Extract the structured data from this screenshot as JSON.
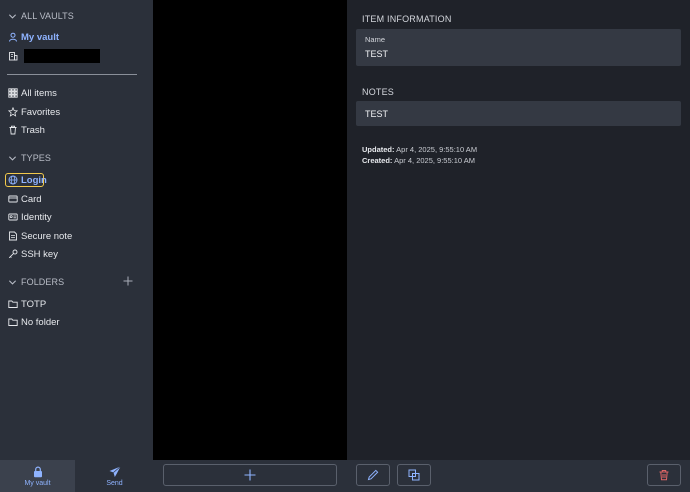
{
  "sidebar": {
    "vaults_header": "ALL VAULTS",
    "my_vault": "My vault",
    "all_items": "All items",
    "favorites": "Favorites",
    "trash": "Trash",
    "types_header": "TYPES",
    "types": [
      "Login",
      "Card",
      "Identity",
      "Secure note",
      "SSH key"
    ],
    "folders_header": "FOLDERS",
    "folders": [
      "TOTP",
      "No folder"
    ]
  },
  "detail": {
    "item_info_title": "ITEM INFORMATION",
    "name_label": "Name",
    "name_value": "TEST",
    "notes_title": "NOTES",
    "notes_value": "TEST",
    "updated_label": "Updated:",
    "updated_value": "Apr 4, 2025, 9:55:10 AM",
    "created_label": "Created:",
    "created_value": "Apr 4, 2025, 9:55:10 AM"
  },
  "bottom_nav": {
    "my_vault": "My vault",
    "send": "Send"
  },
  "colors": {
    "accent": "#8fb3ff",
    "focus_outline": "#f2c94c",
    "danger": "#e06666"
  }
}
